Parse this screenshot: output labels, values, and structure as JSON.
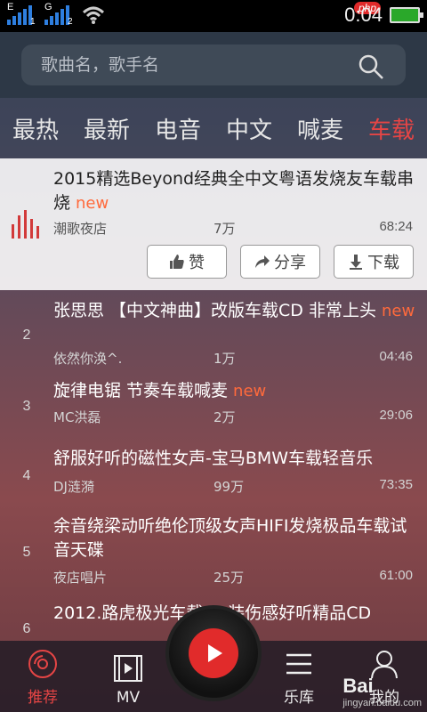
{
  "status": {
    "sim1": "E",
    "sim1_num": "1",
    "sim2": "G",
    "sim2_num": "2",
    "time": "0:04",
    "badge": "php"
  },
  "search": {
    "placeholder": "歌曲名，歌手名"
  },
  "tabs": [
    {
      "label": "最热"
    },
    {
      "label": "最新"
    },
    {
      "label": "电音"
    },
    {
      "label": "中文"
    },
    {
      "label": "喊麦"
    },
    {
      "label": "车载"
    }
  ],
  "active_tab": "车载",
  "songs": [
    {
      "rank": "",
      "title": "2015精选Beyond经典全中文粤语发烧友车载串烧",
      "is_new": "new",
      "artist": "潮歌夜店",
      "plays": "7万",
      "duration": "68:24"
    },
    {
      "rank": "2",
      "title": "张思思 【中文神曲】改版车载CD 非常上头",
      "is_new": "new",
      "artist": "依然你涣^.",
      "plays": "1万",
      "duration": "04:46"
    },
    {
      "rank": "3",
      "title": "旋律电锯 节奏车载喊麦",
      "is_new": "new",
      "artist": "MC洪磊",
      "plays": "2万",
      "duration": "29:06"
    },
    {
      "rank": "4",
      "title": "舒服好听的磁性女声-宝马BMW车载轻音乐",
      "is_new": "",
      "artist": "DJ涟漪",
      "plays": "99万",
      "duration": "73:35"
    },
    {
      "rank": "5",
      "title": "余音绕梁动听绝伦顶级女声HIFI发烧极品车载试音天碟",
      "is_new": "",
      "artist": "夜店唱片",
      "plays": "25万",
      "duration": "61:00"
    },
    {
      "rank": "6",
      "title": "2012.路虎极光车载CD装伤感好听精品CD",
      "is_new": "",
      "artist": "",
      "plays": "",
      "duration": ""
    }
  ],
  "actions": {
    "like": "赞",
    "share": "分享",
    "download": "下载"
  },
  "nav": {
    "recommend": "推荐",
    "mv": "MV",
    "library": "乐库",
    "mine": "我的"
  },
  "watermark": {
    "brand": "Bai",
    "domain": "jingyan.baidu.com"
  },
  "colors": {
    "accent": "#e64545",
    "new_tag": "#ff6a3c",
    "signal": "#2e7fe0",
    "battery": "#2aa82a"
  },
  "icons": [
    "signal-icon",
    "wifi-icon",
    "battery-icon",
    "search-icon",
    "equalizer-icon",
    "thumbs-up-icon",
    "share-icon",
    "download-icon",
    "disc-icon",
    "mv-icon",
    "play-icon",
    "library-icon",
    "user-icon"
  ]
}
